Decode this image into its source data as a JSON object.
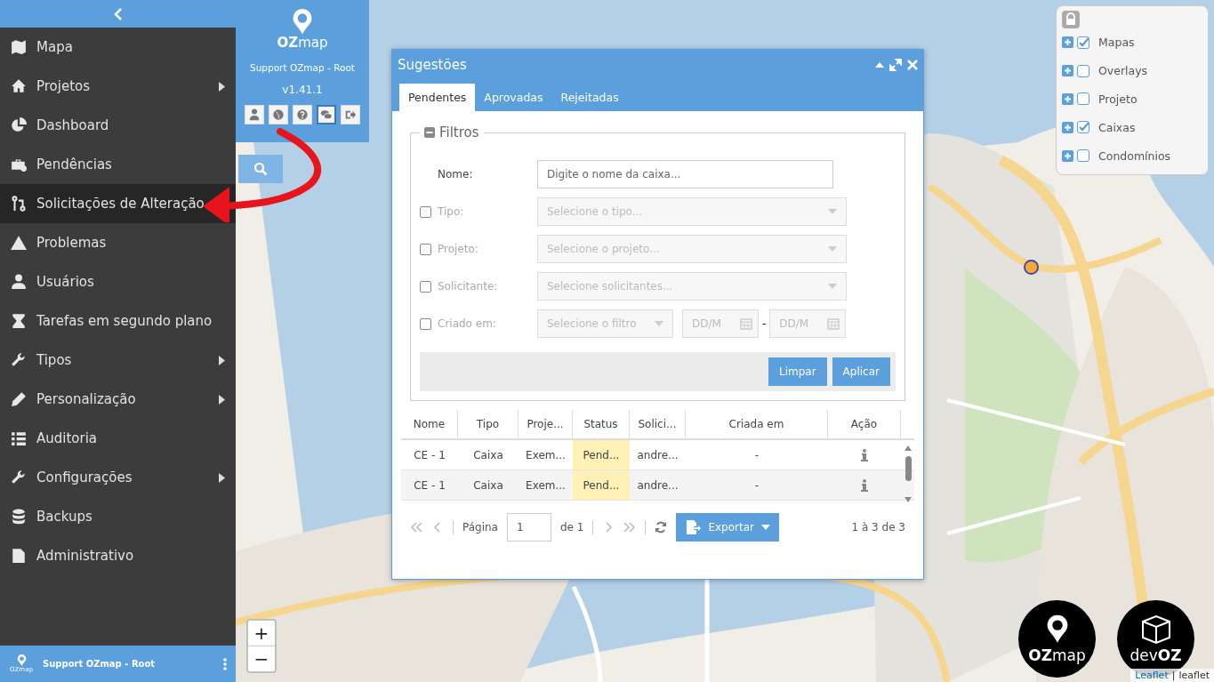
{
  "sidebar": {
    "items": [
      {
        "label": "Mapa",
        "has_submenu": false,
        "selected": false
      },
      {
        "label": "Projetos",
        "has_submenu": true,
        "selected": false
      },
      {
        "label": "Dashboard",
        "has_submenu": false,
        "selected": false
      },
      {
        "label": "Pendências",
        "has_submenu": false,
        "selected": false
      },
      {
        "label": "Solicitações de Alteração",
        "has_submenu": false,
        "selected": true
      },
      {
        "label": "Problemas",
        "has_submenu": false,
        "selected": false
      },
      {
        "label": "Usuários",
        "has_submenu": false,
        "selected": false
      },
      {
        "label": "Tarefas em segundo plano",
        "has_submenu": false,
        "selected": false
      },
      {
        "label": "Tipos",
        "has_submenu": true,
        "selected": false
      },
      {
        "label": "Personalização",
        "has_submenu": true,
        "selected": false
      },
      {
        "label": "Auditoria",
        "has_submenu": false,
        "selected": false
      },
      {
        "label": "Configurações",
        "has_submenu": true,
        "selected": false
      },
      {
        "label": "Backups",
        "has_submenu": false,
        "selected": false
      },
      {
        "label": "Administrativo",
        "has_submenu": false,
        "selected": false
      }
    ],
    "footer": {
      "logo_text": "OZmap",
      "user": "Support OZmap - Root"
    }
  },
  "profile": {
    "logo": "**OZ**map",
    "user": "Support OZmap - Root",
    "version": "v1.41.1",
    "action_buttons": [
      {
        "selected": false
      },
      {
        "selected": false
      },
      {
        "selected": false
      },
      {
        "selected": true
      },
      {
        "selected": false
      }
    ]
  },
  "dialog": {
    "title": "Sugestões",
    "tabs": [
      {
        "label": "Pendentes",
        "selected": true
      },
      {
        "label": "Aprovadas",
        "selected": false
      },
      {
        "label": "Rejeitadas",
        "selected": false
      }
    ],
    "filters": {
      "legend": "Filtros",
      "rows": [
        {
          "kind": "text",
          "label": "Nome:",
          "placeholder": "Digite o nome da caixa..."
        },
        {
          "kind": "select",
          "label": "Tipo:",
          "checked": false,
          "placeholder": "Selecione o tipo..."
        },
        {
          "kind": "select",
          "label": "Projeto:",
          "checked": false,
          "placeholder": "Selecione o projeto..."
        },
        {
          "kind": "select",
          "label": "Solicitante:",
          "checked": false,
          "placeholder": "Selecione solicitantes..."
        },
        {
          "kind": "date_range",
          "label": "Criado em:",
          "checked": false,
          "placeholder": "Selecione o filtro",
          "from_placeholder": "DD/M",
          "separator": "-",
          "to_placeholder": "DD/M"
        }
      ],
      "buttons": [
        "Limpar",
        "Aplicar"
      ]
    },
    "table": {
      "columns": [
        "Nome",
        "Tipo",
        "Proje...",
        "Status",
        "Solici...",
        "Criada em",
        "Ação"
      ],
      "rows": [
        {
          "cells": [
            "CE - 1",
            "Caixa",
            "Exem...",
            "Pend...",
            "andre...",
            "-"
          ]
        },
        {
          "cells": [
            "CE - 1",
            "Caixa",
            "Exem...",
            "Pend...",
            "andre...",
            "-"
          ]
        }
      ]
    },
    "pager": {
      "page_label": "Página",
      "page": "1",
      "of": "de 1",
      "export": "Exportar",
      "summary": "1 à 3 de 3"
    }
  },
  "layers": {
    "items": [
      {
        "label": "Mapas",
        "checked": true
      },
      {
        "label": "Overlays",
        "checked": false
      },
      {
        "label": "Projeto",
        "checked": false
      },
      {
        "label": "Caixas",
        "checked": true
      },
      {
        "label": "Condomínios",
        "checked": false
      }
    ]
  },
  "map": {
    "zoom_in": "+",
    "zoom_out": "−",
    "logos": [
      {
        "kind": "ozmap",
        "text": "**OZ**map"
      },
      {
        "kind": "devoz",
        "text": "dev**OZ**"
      }
    ],
    "attribution": {
      "link": "Leaflet",
      "separator": "|",
      "text": "leaflet"
    }
  }
}
